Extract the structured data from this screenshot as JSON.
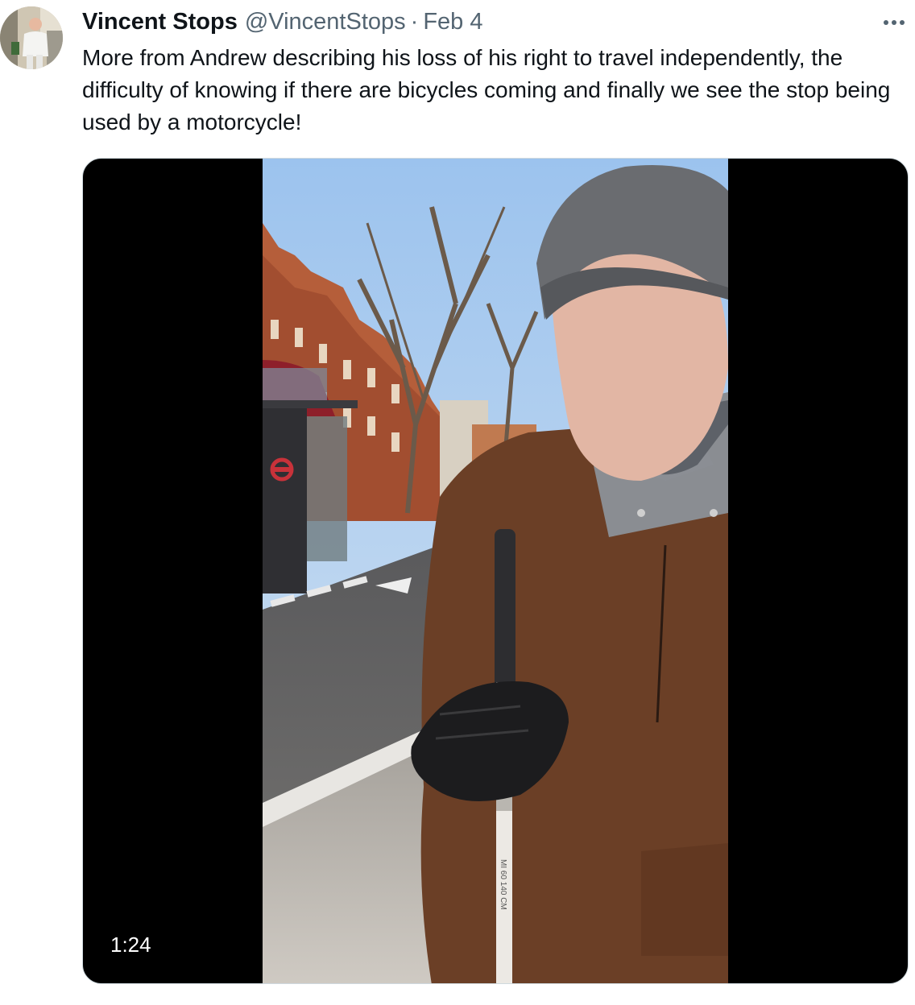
{
  "tweet": {
    "display_name": "Vincent Stops",
    "handle": "@VincentStops",
    "separator": "·",
    "date": "Feb 4",
    "text": "More from Andrew describing his loss of his right to travel independently, the difficulty of knowing if there are bicycles coming and finally we see the stop being used by a motorcycle!",
    "more_icon": "ellipsis-icon"
  },
  "video": {
    "duration": "1:24",
    "cane_label": "MI 60 140 CM"
  },
  "colors": {
    "text_primary": "#0f1419",
    "text_secondary": "#536471",
    "border": "#cfd9de",
    "video_letterbox": "#000000"
  }
}
